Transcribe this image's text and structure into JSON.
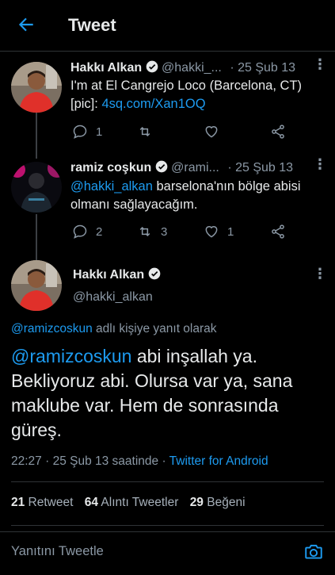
{
  "header": {
    "title": "Tweet"
  },
  "tweets": [
    {
      "name": "Hakkı Alkan",
      "handle": "@hakki_...",
      "date": "· 25 Şub 13",
      "text": "I'm at El Cangrejo Loco (Barcelona, CT)",
      "text2_prefix": "[pic]: ",
      "link": "4sq.com/Xan1OQ",
      "reply_count": "1",
      "retweet_count": "",
      "like_count": ""
    },
    {
      "name": "ramiz coşkun",
      "handle": "@rami...",
      "date": "· 25 Şub 13",
      "mention": "@hakki_alkan",
      "text_rest": " barselona'nın bölge abisi",
      "text2": "olmanı sağlayacağım.",
      "reply_count": "2",
      "retweet_count": "3",
      "like_count": "1"
    }
  ],
  "main": {
    "name": "Hakkı Alkan",
    "handle": "@hakki_alkan",
    "reply_mention": "@ramizcoskun",
    "reply_context": " adlı kişiye yanıt olarak",
    "mention": "@ramizcoskun",
    "line1_rest": " abi inşallah ya.",
    "line2": "Bekliyoruz abi. Olursa var ya, sana",
    "line3": "maklube var.  Hem de sonrasında",
    "line4": "güreş.",
    "time": "22:27",
    "date": " · 25 Şub 13 saatinde · ",
    "source": "Twitter for Android",
    "retweets": "21",
    "retweets_label": " Retweet",
    "quotes": "64",
    "quotes_label": " Alıntı Tweetler",
    "likes": "29",
    "likes_label": " Beğeni"
  },
  "composer": {
    "placeholder": "Yanıtını Tweetle"
  },
  "icons": {
    "back": "arrow-left-icon",
    "verified": "verified-badge-icon",
    "reply": "reply-icon",
    "retweet": "retweet-icon",
    "like": "heart-icon",
    "share": "share-icon",
    "camera": "camera-icon",
    "more": "more-vertical-icon"
  },
  "colors": {
    "accent": "#1d9bf0",
    "background": "#000000",
    "muted": "#8b98a5"
  }
}
